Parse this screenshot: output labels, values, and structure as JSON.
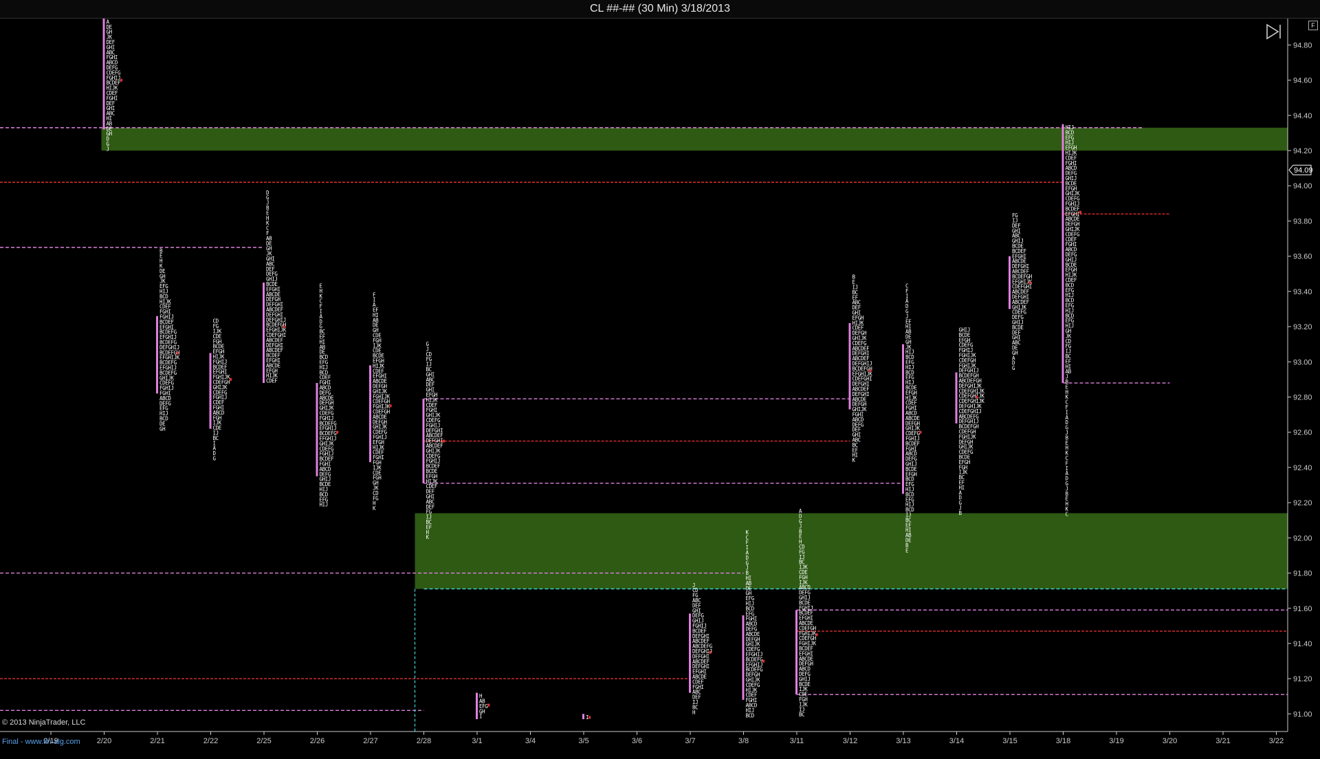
{
  "window": {
    "title": "CL ##-## (30 Min)  3/18/2013"
  },
  "footer": {
    "copyright": "© 2013 NinjaTrader, LLC",
    "website": "Final - www.fin-alg.com"
  },
  "toolbar": {
    "f_label": "F"
  },
  "colors": {
    "background": "#000000",
    "tpo_letters": "#ffffff",
    "value_area_bar": "#e080e0",
    "magenta_line": "#e080e0",
    "red_line": "#e03030",
    "green_zone": "#2e5a14",
    "cyan_line": "#40d8d8",
    "axis": "#cccccc"
  },
  "chart_data": {
    "type": "market_profile",
    "title": "CL ##-## (30 Min)  3/18/2013",
    "ylim": [
      90.9,
      94.95
    ],
    "yticks": [
      91.0,
      91.2,
      91.4,
      91.6,
      91.8,
      92.0,
      92.2,
      92.4,
      92.6,
      92.8,
      93.0,
      93.2,
      93.4,
      93.6,
      93.8,
      94.0,
      94.2,
      94.4,
      94.6,
      94.8
    ],
    "ytick_labels": [
      "91.00",
      "91.20",
      "91.40",
      "91.60",
      "91.80",
      "92.00",
      "92.20",
      "92.40",
      "92.60",
      "92.80",
      "93.00",
      "93.20",
      "93.40",
      "93.60",
      "93.80",
      "94.00",
      "94.20",
      "94.40",
      "94.60",
      "94.80"
    ],
    "current_price": 94.09,
    "current_price_label": "94.09",
    "sessions": [
      "2/19",
      "2/20",
      "2/21",
      "2/22",
      "2/25",
      "2/26",
      "2/27",
      "2/28",
      "3/1",
      "3/4",
      "3/5",
      "3/6",
      "3/7",
      "3/8",
      "3/11",
      "3/12",
      "3/13",
      "3/14",
      "3/15",
      "3/18",
      "3/19",
      "3/20",
      "3/21",
      "3/22"
    ],
    "profiles": [
      {
        "session": "2/20",
        "low": 94.18,
        "high": 94.95,
        "va_low": 94.32,
        "va_high": 94.95,
        "poc": 94.6,
        "width": 5
      },
      {
        "session": "2/21",
        "low": 92.6,
        "high": 93.65,
        "va_low": 92.82,
        "va_high": 93.26,
        "poc": 93.05,
        "width": 7
      },
      {
        "session": "2/22",
        "low": 92.43,
        "high": 93.25,
        "va_low": 92.62,
        "va_high": 93.05,
        "poc": 92.9,
        "width": 6
      },
      {
        "session": "2/25",
        "low": 92.88,
        "high": 93.98,
        "va_low": 92.88,
        "va_high": 93.45,
        "poc": 93.2,
        "width": 7
      },
      {
        "session": "2/26",
        "low": 92.15,
        "high": 93.45,
        "va_low": 92.35,
        "va_high": 92.88,
        "poc": 92.6,
        "width": 6
      },
      {
        "session": "2/27",
        "low": 92.15,
        "high": 93.4,
        "va_low": 92.43,
        "va_high": 92.98,
        "poc": 92.75,
        "width": 6
      },
      {
        "session": "2/28",
        "low": 91.97,
        "high": 93.12,
        "va_low": 92.31,
        "va_high": 92.79,
        "poc": 92.55,
        "width": 6
      },
      {
        "session": "3/1",
        "low": 90.97,
        "high": 91.12,
        "va_low": 90.97,
        "va_high": 91.12,
        "poc": 91.05,
        "width": 3
      },
      {
        "session": "3/5",
        "low": 90.97,
        "high": 91.0,
        "va_low": 90.97,
        "va_high": 91.0,
        "poc": 90.98,
        "width": 1
      },
      {
        "session": "3/7",
        "low": 90.97,
        "high": 91.75,
        "va_low": 91.12,
        "va_high": 91.57,
        "poc": 91.35,
        "width": 7
      },
      {
        "session": "3/8",
        "low": 90.97,
        "high": 92.05,
        "va_low": 91.08,
        "va_high": 91.56,
        "poc": 91.3,
        "width": 6
      },
      {
        "session": "3/11",
        "low": 90.97,
        "high": 92.17,
        "va_low": 91.11,
        "va_high": 91.59,
        "poc": 91.45,
        "width": 6
      },
      {
        "session": "3/12",
        "low": 92.43,
        "high": 93.5,
        "va_low": 92.73,
        "va_high": 93.22,
        "poc": 92.95,
        "width": 7
      },
      {
        "session": "3/13",
        "low": 91.9,
        "high": 93.45,
        "va_low": 92.25,
        "va_high": 93.1,
        "poc": 92.6,
        "width": 5
      },
      {
        "session": "3/14",
        "low": 92.12,
        "high": 93.2,
        "va_low": 92.65,
        "va_high": 92.94,
        "poc": 92.8,
        "width": 9
      },
      {
        "session": "3/15",
        "low": 92.95,
        "high": 93.85,
        "va_low": 93.3,
        "va_high": 93.6,
        "poc": 93.45,
        "width": 7
      },
      {
        "session": "3/18",
        "low": 92.12,
        "high": 94.35,
        "va_low": 92.88,
        "va_high": 94.35,
        "poc": 93.85,
        "width": 5
      }
    ],
    "zones": [
      {
        "from_session": "2/20",
        "to_session": "end",
        "low": 94.2,
        "high": 94.33
      },
      {
        "from_session": "2/28",
        "to_session": "end",
        "low": 91.71,
        "high": 92.14
      }
    ],
    "levels": [
      {
        "price": 94.33,
        "color": "magenta",
        "from_session": "start",
        "to_session": "3/19.5"
      },
      {
        "price": 94.02,
        "color": "red",
        "from_session": "start",
        "to_session": "3/18"
      },
      {
        "price": 93.65,
        "color": "magenta",
        "from_session": "start",
        "to_session": "2/25"
      },
      {
        "price": 93.84,
        "color": "red",
        "from_session": "3/18",
        "to_session": "3/20"
      },
      {
        "price": 92.88,
        "color": "magenta",
        "from_session": "3/18",
        "to_session": "3/20"
      },
      {
        "price": 92.79,
        "color": "magenta",
        "from_session": "2/28",
        "to_session": "3/12"
      },
      {
        "price": 92.55,
        "color": "red",
        "from_session": "2/28",
        "to_session": "3/12"
      },
      {
        "price": 92.31,
        "color": "magenta",
        "from_session": "2/28",
        "to_session": "3/13"
      },
      {
        "price": 91.8,
        "color": "magenta",
        "from_session": "start",
        "to_session": "3/8"
      },
      {
        "price": 91.71,
        "color": "cyan",
        "from_session": "2/28",
        "to_session": "end"
      },
      {
        "price": 91.59,
        "color": "magenta",
        "from_session": "3/11",
        "to_session": "end"
      },
      {
        "price": 91.47,
        "color": "red",
        "from_session": "3/11",
        "to_session": "end"
      },
      {
        "price": 91.11,
        "color": "magenta",
        "from_session": "3/11",
        "to_session": "end"
      },
      {
        "price": 91.2,
        "color": "red",
        "from_session": "start",
        "to_session": "3/7"
      },
      {
        "price": 91.02,
        "color": "magenta",
        "from_session": "start",
        "to_session": "2/28"
      }
    ],
    "tpo_letters": [
      "A",
      "B",
      "C",
      "D",
      "E",
      "F",
      "G",
      "H",
      "I",
      "J",
      "K"
    ],
    "grid": false,
    "legend": "none"
  }
}
